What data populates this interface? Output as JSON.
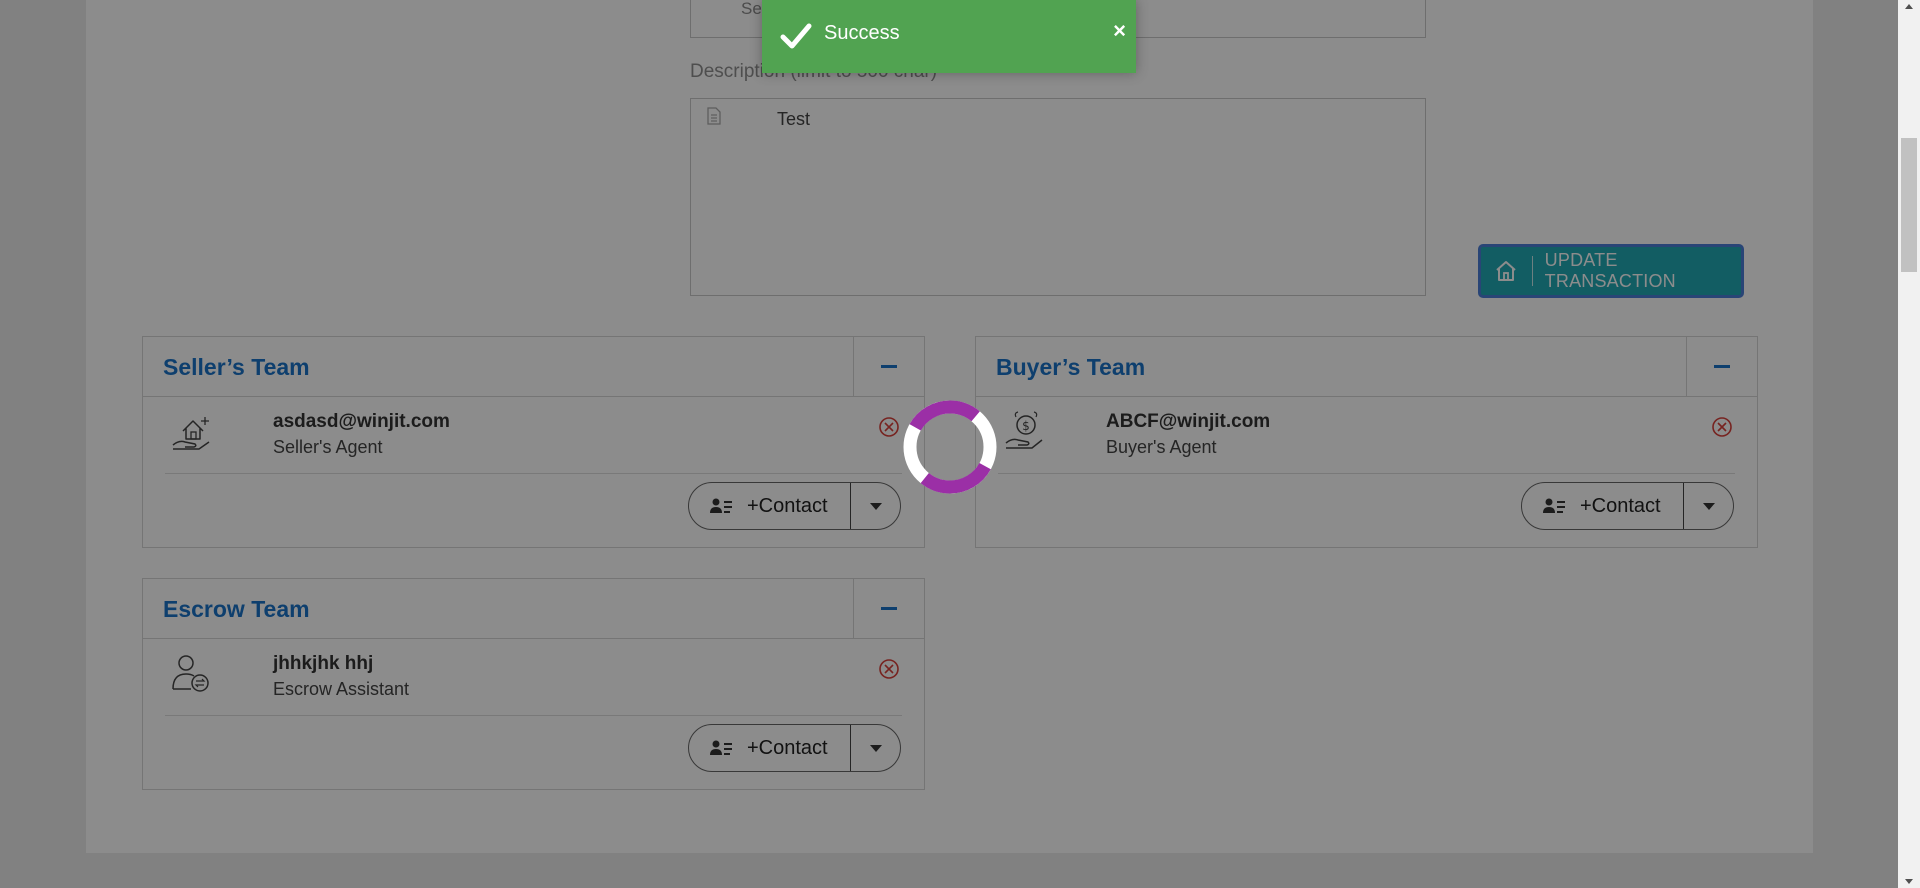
{
  "form": {
    "top_field_value": "Se",
    "description_label": "Description (limit to 500 char)",
    "description_value": "Test",
    "update_button_label": "UPDATE TRANSACTION"
  },
  "teams": [
    {
      "title": "Seller’s Team",
      "member": {
        "name": "asdasd@winjit.com",
        "role": "Seller's Agent",
        "icon": "house-in-hand-icon"
      },
      "contact_label": "+Contact"
    },
    {
      "title": "Buyer’s Team",
      "member": {
        "name": "ABCF@winjit.com",
        "role": "Buyer's Agent",
        "icon": "money-in-hand-icon"
      },
      "contact_label": "+Contact"
    },
    {
      "title": "Escrow Team",
      "member": {
        "name": "jhhkjhk hhj",
        "role": "Escrow Assistant",
        "icon": "person-transfer-icon"
      },
      "contact_label": "+Contact"
    }
  ],
  "toast": {
    "message": "Success",
    "close": "×"
  },
  "colors": {
    "accent": "#1a73c8",
    "button_teal": "#22a9b5",
    "toast_green": "#51a351",
    "spinner_purple": "#9b2fa6",
    "remove_red": "#d9413b"
  }
}
